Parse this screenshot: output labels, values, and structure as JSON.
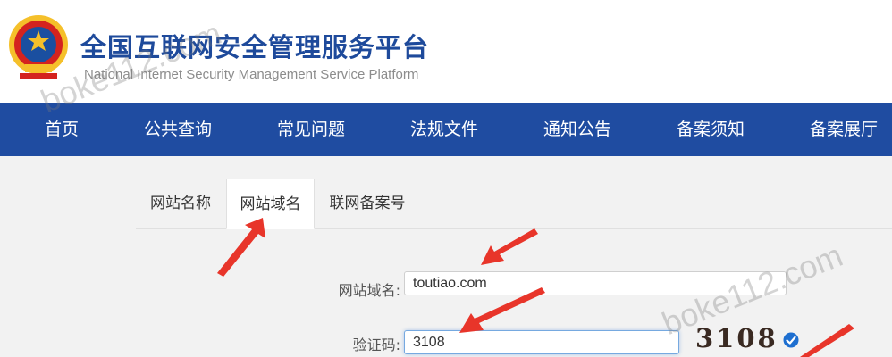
{
  "header": {
    "title": "全国互联网安全管理服务平台",
    "subtitle": "National Internet Security Management Service Platform",
    "brand_color": "#1e4a9b"
  },
  "nav": {
    "background": "#1f4ca1",
    "items": [
      "首页",
      "公共查询",
      "常见问题",
      "法规文件",
      "通知公告",
      "备案须知",
      "备案展厅"
    ]
  },
  "tabs": [
    {
      "label": "网站名称",
      "active": false
    },
    {
      "label": "网站域名",
      "active": true
    },
    {
      "label": "联网备案号",
      "active": false
    }
  ],
  "form": {
    "domain_label": "网站域名:",
    "domain_value": "toutiao.com",
    "captcha_label": "验证码:",
    "captcha_value": "3108",
    "captcha_image_text": "3108",
    "captcha_status_icon": "check-circle-icon"
  },
  "watermarks": [
    "boke112.com",
    "boke112.com"
  ],
  "annotation_color": "#e8352a"
}
